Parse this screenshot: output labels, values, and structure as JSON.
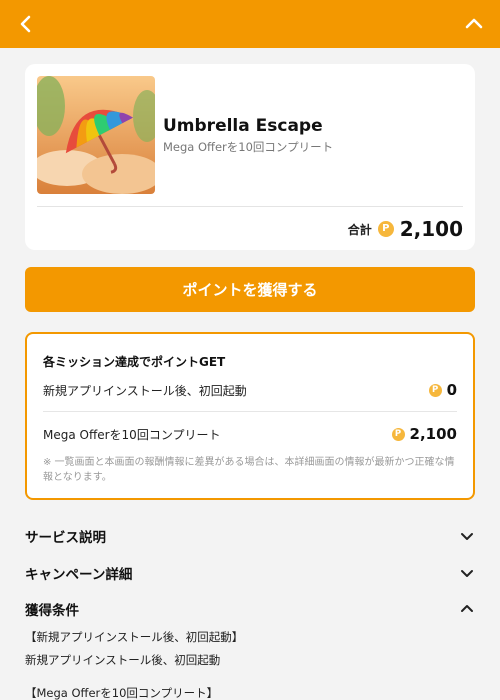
{
  "header": {
    "back_icon": "chevron-left-icon",
    "collapse_icon": "chevron-up-icon",
    "bg_color": "#f39800"
  },
  "offer": {
    "image": "umbrella-artwork",
    "title": "Umbrella Escape",
    "subtitle": "Mega Offerを10回コンプリート",
    "total_label": "合計",
    "coin_symbol": "P",
    "total_value": "2,100"
  },
  "cta": {
    "label": "ポイントを獲得する",
    "color": "#f39800"
  },
  "missions": {
    "heading": "各ミッション達成でポイントGET",
    "items": [
      {
        "label": "新規アプリインストール後、初回起動",
        "points": "0"
      },
      {
        "label": "Mega Offerを10回コンプリート",
        "points": "2,100"
      }
    ],
    "note": "※ 一覧画面と本画面の報酬情報に差異がある場合は、本詳細画面の情報が最新かつ正確な情報となります。"
  },
  "sections": [
    {
      "title": "サービス説明",
      "state": "collapsed"
    },
    {
      "title": "キャンペーン詳細",
      "state": "collapsed"
    },
    {
      "title": "獲得条件",
      "state": "expanded"
    }
  ],
  "conditions": {
    "heading1": "【新規アプリインストール後、初回起動】",
    "body1": "新規アプリインストール後、初回起動",
    "heading2": "【Mega Offerを10回コンプリート】"
  },
  "accent_color": "#f39800"
}
